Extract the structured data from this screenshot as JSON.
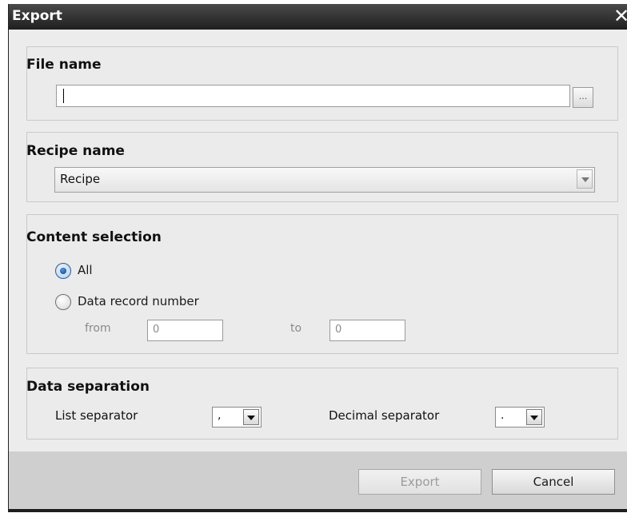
{
  "window": {
    "title": "Export",
    "close_glyph": "✕"
  },
  "file_name": {
    "title": "File name",
    "value": "",
    "browse_label": "..."
  },
  "recipe_name": {
    "title": "Recipe name",
    "selected": "Recipe"
  },
  "content_selection": {
    "title": "Content selection",
    "options": [
      {
        "label": "All",
        "checked": true
      },
      {
        "label": "Data record number",
        "checked": false
      }
    ],
    "from_label": "from",
    "from_value": "0",
    "to_label": "to",
    "to_value": "0"
  },
  "data_separation": {
    "title": "Data separation",
    "list_separator_label": "List separator",
    "list_separator_value": ",",
    "decimal_separator_label": "Decimal separator",
    "decimal_separator_value": "."
  },
  "buttons": {
    "export_label": "Export",
    "cancel_label": "Cancel"
  },
  "icons": {
    "close": "close-icon",
    "dropdown": "chevron-down-icon",
    "radio_checked": "radio-checked-icon",
    "radio_unchecked": "radio-unchecked-icon"
  },
  "colors": {
    "titlebar": "#1f1f1f",
    "radio_accent": "#0a3f86"
  }
}
